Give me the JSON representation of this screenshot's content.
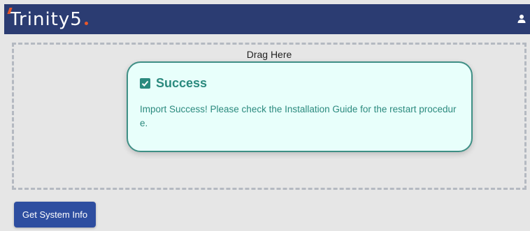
{
  "header": {
    "logo_text": "Trinity5",
    "user_icon": "user-icon"
  },
  "dropzone": {
    "label": "Drag Here"
  },
  "modal": {
    "icon": "checkbox-checked-icon",
    "title": "Success",
    "message": "Import Success! Please check the Installation Guide for the restart procedure."
  },
  "actions": {
    "system_info_label": "Get System Info"
  },
  "colors": {
    "header_bg": "#2b3c72",
    "success_accent": "#2b8a7e",
    "modal_bg": "#e8fffb",
    "button_bg": "#2e4ea0"
  }
}
